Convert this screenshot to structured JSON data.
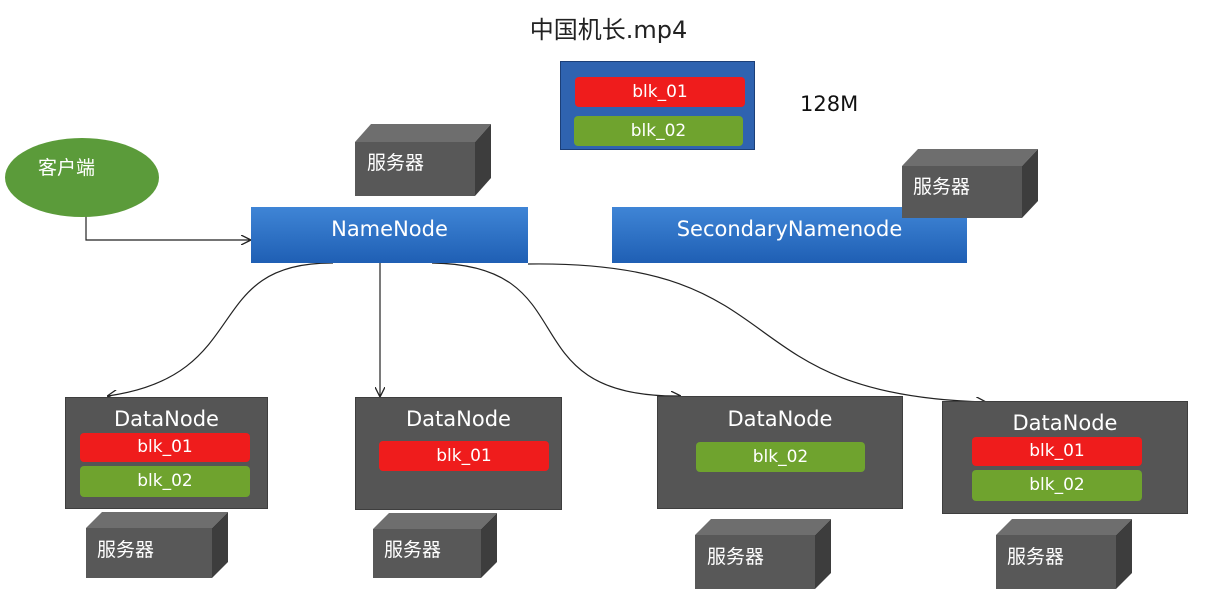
{
  "file": {
    "title": "中国机长.mp4",
    "size": "128M",
    "blocks": [
      "blk_01",
      "blk_02"
    ]
  },
  "client": {
    "label": "客户端"
  },
  "namenode": {
    "label": "NameNode",
    "server_label": "服务器"
  },
  "secondary": {
    "label": "SecondaryNamenode",
    "server_label": "服务器"
  },
  "datanodes": [
    {
      "label": "DataNode",
      "blocks": [
        "blk_01",
        "blk_02"
      ],
      "server_label": "服务器"
    },
    {
      "label": "DataNode",
      "blocks": [
        "blk_01"
      ],
      "server_label": "服务器"
    },
    {
      "label": "DataNode",
      "blocks": [
        "blk_02"
      ],
      "server_label": "服务器"
    },
    {
      "label": "DataNode",
      "blocks": [
        "blk_01",
        "blk_02"
      ],
      "server_label": "服务器"
    }
  ],
  "colors": {
    "blk_01": "#ef1c1c",
    "blk_02": "#6fa32e",
    "node_bar": "#2a6fc6",
    "server": "#555555",
    "client": "#5b9b3a"
  }
}
